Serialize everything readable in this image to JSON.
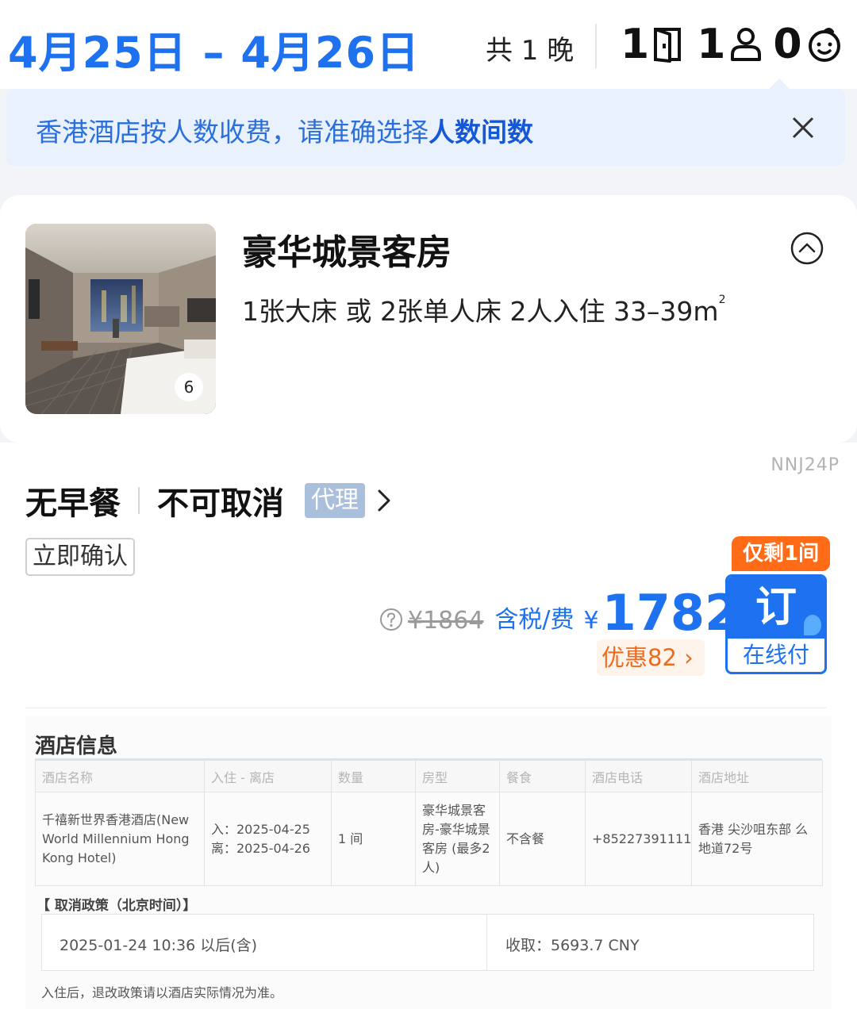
{
  "header": {
    "date_range": "4月25日 – 4月26日",
    "nights": "共 1 晚",
    "rooms": "1",
    "adults": "1",
    "children": "0"
  },
  "notice": {
    "text_prefix": "香港酒店按人数收费，请准确选择",
    "text_highlight": "人数间数"
  },
  "room": {
    "photo_count": "6",
    "title": "豪华城景客房",
    "specs": "1张大床 或 2张单人床  2人入住  33–39m",
    "area_sup": "2"
  },
  "rate": {
    "code": "NNJ24P",
    "meal": "无早餐",
    "cancel": "不可取消",
    "agent_tag": "代理",
    "confirm_tag": "立即确认",
    "original_price": "¥1864",
    "tax_label": "含税/费",
    "currency": "¥",
    "price": "1782",
    "discount": "优惠82",
    "scarcity": "仅剩1间",
    "book_label": "订",
    "book_sub": "在线付"
  },
  "hotel_info": {
    "title": "酒店信息",
    "columns": [
      "酒店名称",
      "入住 - 离店",
      "数量",
      "房型",
      "餐食",
      "酒店电话",
      "酒店地址"
    ],
    "row": [
      "千禧新世界香港酒店(New World Millennium Hong Kong Hotel)",
      "入：2025-04-25\n离：2025-04-26",
      "1 间",
      "豪华城景客房-豪华城景客房 (最多2人)",
      "不含餐",
      "+85227391111",
      "香港 尖沙咀东部 么地道72号"
    ],
    "cancel_heading": "【 取消政策（北京时间）】",
    "cancel_time": "2025-01-24 10:36 以后(含)",
    "cancel_fee": "收取：5693.7 CNY",
    "note": "入住后，退改政策请以酒店实际情况为准。"
  },
  "colors": {
    "brand_blue": "#1e72f0",
    "notice_bg": "#e9f1fd",
    "orange": "#ff6b17"
  }
}
